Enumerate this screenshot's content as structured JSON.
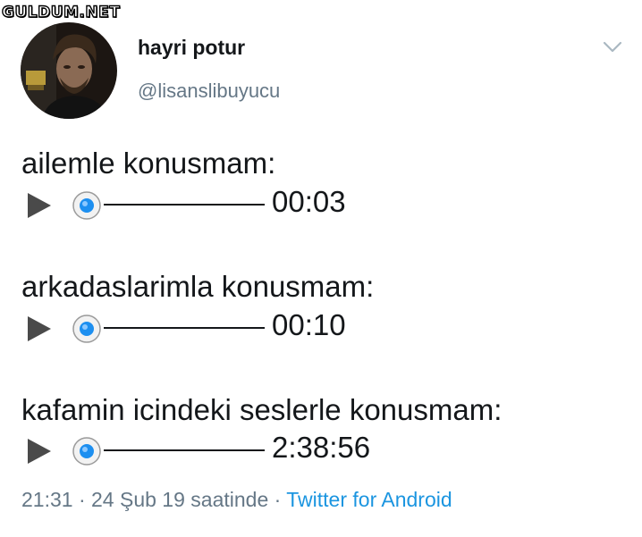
{
  "watermark": "GULDUM.NET",
  "author": {
    "name": "hayri potur",
    "handle": "@lisanslibuyucu"
  },
  "tweet": {
    "lines": [
      {
        "label": "ailemle konusmam:",
        "duration": "00:03"
      },
      {
        "label": "arkadaslarimla konusmam:",
        "duration": "00:10"
      },
      {
        "label": "kafamin icindeki seslerle konusmam:",
        "duration": "2:38:56"
      }
    ]
  },
  "meta": {
    "time": "21:31",
    "separator": "·",
    "date": "24 Şub 19 saatinde",
    "source": "Twitter for Android"
  },
  "icons": {
    "caret": "chevron-down-icon",
    "play": "play-icon",
    "seek": "seek-knob-icon"
  },
  "colors": {
    "text": "#14171a",
    "secondary": "#657786",
    "link": "#1b95e0",
    "knob": "#1d8ff0"
  }
}
